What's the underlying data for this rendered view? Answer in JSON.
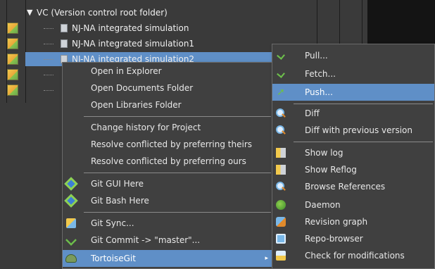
{
  "tree": {
    "root": {
      "label": "VC (Version control root folder)",
      "expand_icon": "triangle-down-icon"
    },
    "rows": [
      {
        "label": "NJ-NA integrated simulation",
        "status_icon": "folder-status-icon"
      },
      {
        "label": "NJ-NA integrated simulation1",
        "status_icon": "folder-status-icon"
      },
      {
        "label": "NJ-NA integrated simulation2",
        "status_icon": "folder-status-icon",
        "selected": true
      },
      {
        "label": "",
        "status_icon": "folder-status-icon"
      },
      {
        "label": "",
        "status_icon": "folder-status-icon"
      }
    ]
  },
  "context_menu": {
    "items": [
      {
        "label": "Open in Explorer"
      },
      {
        "label": "Open Documents Folder"
      },
      {
        "label": "Open Libraries Folder"
      },
      {
        "label": "Change history for Project"
      },
      {
        "label": "Resolve conflicted by preferring theirs"
      },
      {
        "label": "Resolve conflicted by preferring ours"
      },
      {
        "label": "Git GUI Here",
        "icon": "git-gui-icon"
      },
      {
        "label": "Git Bash Here",
        "icon": "git-bash-icon"
      },
      {
        "label": "Git Sync...",
        "icon": "git-sync-icon"
      },
      {
        "label": "Git Commit -> \"master\"...",
        "icon": "git-commit-icon"
      },
      {
        "label": "TortoiseGit",
        "icon": "tortoisegit-icon",
        "highlighted": true,
        "has_submenu": true
      }
    ],
    "submenu_arrow": "▸"
  },
  "sub_menu": {
    "items": [
      {
        "label": "Pull...",
        "icon": "pull-icon"
      },
      {
        "label": "Fetch...",
        "icon": "fetch-icon"
      },
      {
        "label": "Push...",
        "icon": "push-icon",
        "highlighted": true
      },
      {
        "label": "Diff",
        "icon": "diff-icon"
      },
      {
        "label": "Diff with previous version",
        "icon": "diff-previous-icon"
      },
      {
        "label": "Show log",
        "icon": "show-log-icon"
      },
      {
        "label": "Show Reflog",
        "icon": "show-reflog-icon"
      },
      {
        "label": "Browse References",
        "icon": "browse-references-icon"
      },
      {
        "label": "Daemon",
        "icon": "daemon-icon"
      },
      {
        "label": "Revision graph",
        "icon": "revision-graph-icon"
      },
      {
        "label": "Repo-browser",
        "icon": "repo-browser-icon"
      },
      {
        "label": "Check for modifications",
        "icon": "check-modifications-icon"
      }
    ]
  },
  "colors": {
    "selection": "#5f8fc7",
    "background": "#3d3d3d",
    "menu_background": "#404040",
    "text": "#e8e8e8"
  }
}
